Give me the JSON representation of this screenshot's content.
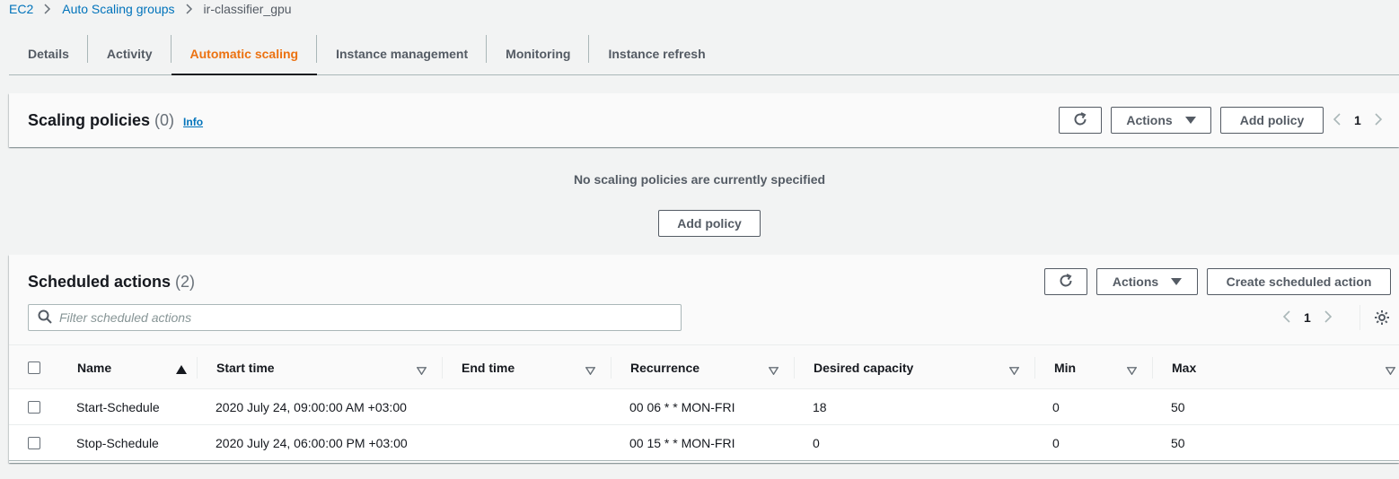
{
  "breadcrumb": {
    "items": [
      "EC2",
      "Auto Scaling groups"
    ],
    "current": "ir-classifier_gpu"
  },
  "tabs": [
    {
      "label": "Details"
    },
    {
      "label": "Activity"
    },
    {
      "label": "Automatic scaling",
      "active": true
    },
    {
      "label": "Instance management"
    },
    {
      "label": "Monitoring"
    },
    {
      "label": "Instance refresh"
    }
  ],
  "scaling_policies": {
    "title": "Scaling policies",
    "count": "(0)",
    "info": "Info",
    "actions_label": "Actions",
    "add_policy_label": "Add policy",
    "page": "1",
    "empty_text": "No scaling policies are currently specified",
    "empty_add_label": "Add policy"
  },
  "scheduled_actions": {
    "title": "Scheduled actions",
    "count": "(2)",
    "actions_label": "Actions",
    "create_label": "Create scheduled action",
    "page": "1",
    "filter_placeholder": "Filter scheduled actions",
    "columns": [
      "Name",
      "Start time",
      "End time",
      "Recurrence",
      "Desired capacity",
      "Min",
      "Max"
    ],
    "rows": [
      {
        "name": "Start-Schedule",
        "start_time": "2020 July 24, 09:00:00 AM +03:00",
        "end_time": "",
        "recurrence": "00 06 * * MON-FRI",
        "desired": "18",
        "min": "0",
        "max": "50"
      },
      {
        "name": "Stop-Schedule",
        "start_time": "2020 July 24, 06:00:00 PM +03:00",
        "end_time": "",
        "recurrence": "00 15 * * MON-FRI",
        "desired": "0",
        "min": "0",
        "max": "50"
      }
    ]
  },
  "colors": {
    "accent": "#ec7211",
    "link": "#0073bb",
    "background": "#f2f3f3"
  }
}
